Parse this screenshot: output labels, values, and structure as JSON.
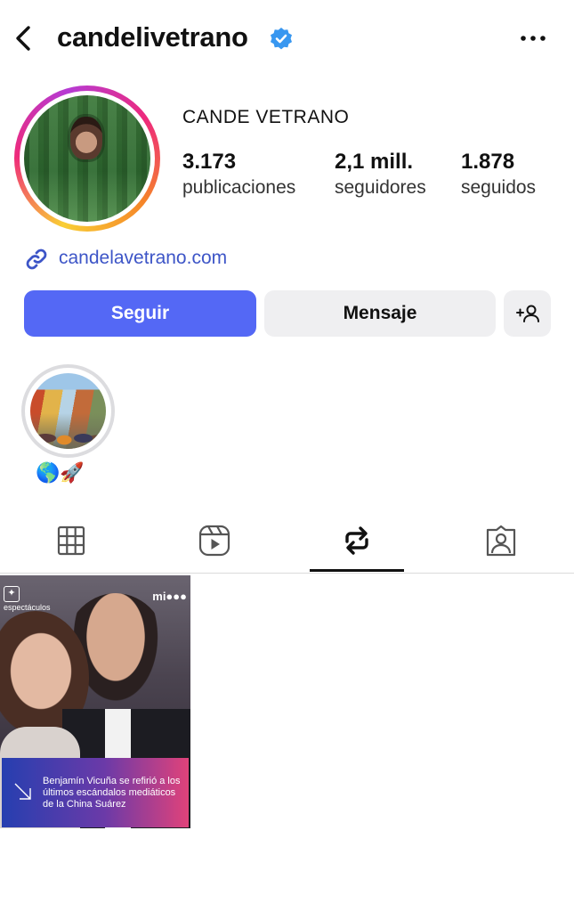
{
  "header": {
    "username": "candelivetrano"
  },
  "profile": {
    "full_name": "CANDE VETRANO",
    "stats": [
      {
        "value": "3.173",
        "label": "publicaciones"
      },
      {
        "value": "2,1 mill.",
        "label": "seguidores"
      },
      {
        "value": "1.878",
        "label": "seguidos"
      }
    ],
    "link": "candelavetrano.com"
  },
  "actions": {
    "follow_label": "Seguir",
    "message_label": "Mensaje"
  },
  "highlights": [
    {
      "label": "🌎🚀"
    }
  ],
  "tabs": {
    "active": "reposts",
    "items": [
      "grid",
      "reels",
      "reposts",
      "tagged"
    ]
  },
  "post": {
    "section_badge": "espectáculos",
    "brand": "mi●●●",
    "caption": "Benjamín Vicuña se refirió a los últimos escándalos mediáticos de la China Suárez"
  },
  "colors": {
    "accent": "#5468f5",
    "link": "#3d55c7",
    "verified": "#3897f0"
  }
}
